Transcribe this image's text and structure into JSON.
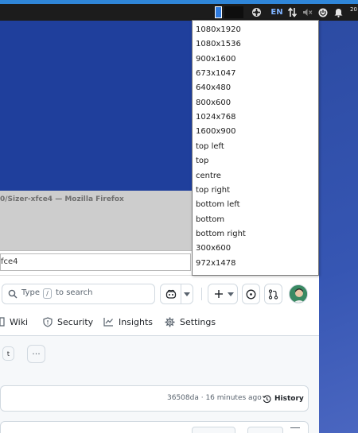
{
  "panel": {
    "language": "EN",
    "clock": "20",
    "colors": {
      "panel": "#1c1c1c",
      "accent": "#2f86d9",
      "lang": "#7fb3ff"
    },
    "icons": [
      "workspace-active",
      "workspace",
      "network-icon",
      "transfer-icon",
      "volume-muted-icon",
      "power-icon",
      "notification-bell-icon"
    ]
  },
  "window": {
    "title": "0/Sizer-xfce4 — Mozilla Firefox",
    "url": "fce4"
  },
  "github": {
    "search_prefix": "Type",
    "search_key": "/",
    "search_suffix": "to search",
    "nav": {
      "wiki": "Wiki",
      "security": "Security",
      "insights": "Insights",
      "settings": "Settings"
    },
    "t_button": "t",
    "more_button": "···",
    "commit_meta": "36508da · 16 minutes ago",
    "history": "History",
    "colors": {
      "border": "#d1d9e0",
      "text": "#1f2328",
      "muted": "#59636e"
    }
  },
  "dropdown": {
    "items": [
      "1080x1920",
      "1080x1536",
      "900x1600",
      "673x1047",
      "640x480",
      "800x600",
      "1024x768",
      "1600x900",
      "top left",
      "top",
      "centre",
      "top right",
      "bottom left",
      "bottom",
      "bottom right",
      "300x600",
      "972x1478"
    ]
  }
}
